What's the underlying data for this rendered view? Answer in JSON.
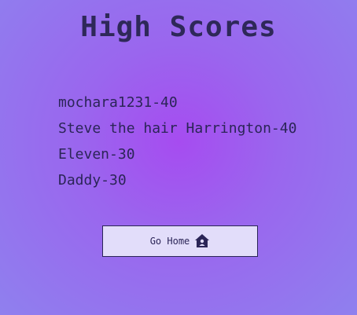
{
  "page": {
    "title": "High Scores"
  },
  "scores": [
    {
      "text": "mochara1231-40"
    },
    {
      "text": "Steve the hair Harrington-40"
    },
    {
      "text": "Eleven-30"
    },
    {
      "text": "Daddy-30"
    }
  ],
  "home_button": {
    "label": "Go Home",
    "icon": "home-icon"
  },
  "colors": {
    "background_center": "#a64cf0",
    "background_edge": "#8f80ee",
    "text": "#2b2557",
    "button_bg": "#e2ddfa"
  }
}
